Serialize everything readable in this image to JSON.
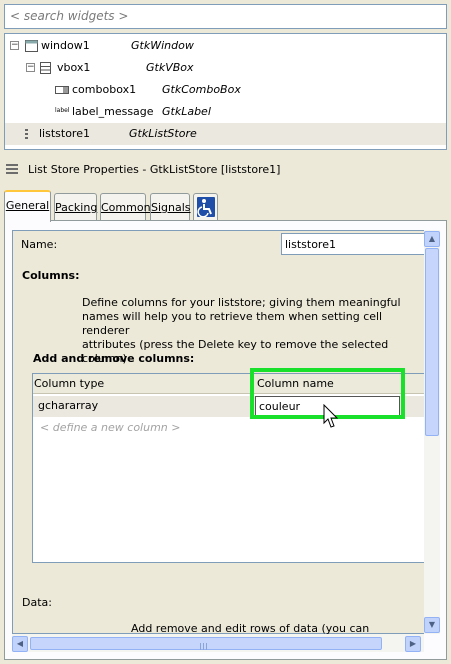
{
  "search": {
    "placeholder": "< search widgets >"
  },
  "tree": {
    "rows": [
      {
        "name": "window1",
        "type": "GtkWindow",
        "expander": "−"
      },
      {
        "name": "vbox1",
        "type": "GtkVBox",
        "expander": "−"
      },
      {
        "name": "combobox1",
        "type": "GtkComboBox"
      },
      {
        "name": "label_message",
        "type": "GtkLabel",
        "icon_text": "label"
      },
      {
        "name": "liststore1",
        "type": "GtkListStore"
      }
    ]
  },
  "properties": {
    "title": "List Store Properties - GtkListStore [liststore1]",
    "tabs": [
      {
        "label": "General"
      },
      {
        "label": "Packing"
      },
      {
        "label": "Common"
      },
      {
        "label": "Signals"
      },
      {
        "label": "",
        "icon": "accessibility-icon"
      }
    ],
    "name_label": "Name:",
    "name_value": "liststore1",
    "columns_heading": "Columns:",
    "columns_description": [
      "Define columns for your liststore; giving them meaningful",
      "names will help you to retrieve them when setting cell renderer",
      "attributes (press the Delete key to remove the selected column)"
    ],
    "add_remove_heading": "Add and remove columns:",
    "table": {
      "headers": [
        "Column type",
        "Column name"
      ],
      "rows": [
        {
          "type": "gchararray",
          "name": "couleur"
        }
      ],
      "new_column_placeholder": "< define a new column >"
    },
    "data_label": "Data:",
    "data_description": "Add remove and edit rows of data (you can"
  },
  "colors": {
    "highlight": "#19e02a",
    "selected_row": "#ebe8df"
  }
}
